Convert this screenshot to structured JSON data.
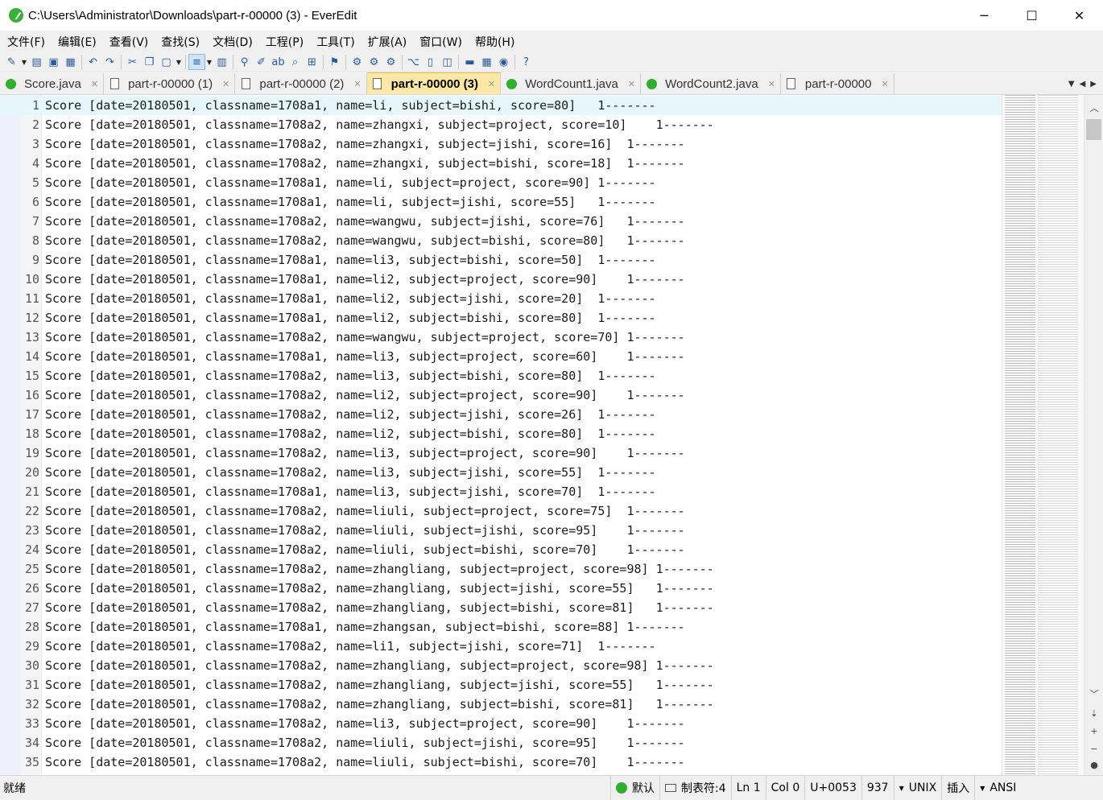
{
  "window": {
    "title": "C:\\Users\\Administrator\\Downloads\\part-r-00000 (3) - EverEdit",
    "minimize": "─",
    "maximize": "☐",
    "close": "✕"
  },
  "menu": [
    "文件(F)",
    "编辑(E)",
    "查看(V)",
    "查找(S)",
    "文档(D)",
    "工程(P)",
    "工具(T)",
    "扩展(A)",
    "窗口(W)",
    "帮助(H)"
  ],
  "tabs": [
    {
      "label": "Score.java",
      "icon": "java-file-icon",
      "active": false
    },
    {
      "label": "part-r-00000 (1)",
      "icon": "text-file-icon",
      "active": false
    },
    {
      "label": "part-r-00000 (2)",
      "icon": "text-file-icon",
      "active": false
    },
    {
      "label": "part-r-00000 (3)",
      "icon": "text-file-icon",
      "active": true
    },
    {
      "label": "WordCount1.java",
      "icon": "java-file-icon",
      "active": false
    },
    {
      "label": "WordCount2.java",
      "icon": "java-file-icon",
      "active": false
    },
    {
      "label": "part-r-00000",
      "icon": "text-file-icon",
      "active": false
    }
  ],
  "editor": {
    "current_line": 1,
    "lines": [
      {
        "n": "1",
        "text": "Score [date=20180501, classname=1708a1, name=li, subject=bishi, score=80]   1-------"
      },
      {
        "n": "2",
        "text": "Score [date=20180501, classname=1708a2, name=zhangxi, subject=project, score=10]    1-------"
      },
      {
        "n": "3",
        "text": "Score [date=20180501, classname=1708a2, name=zhangxi, subject=jishi, score=16]  1-------"
      },
      {
        "n": "4",
        "text": "Score [date=20180501, classname=1708a2, name=zhangxi, subject=bishi, score=18]  1-------"
      },
      {
        "n": "5",
        "text": "Score [date=20180501, classname=1708a1, name=li, subject=project, score=90] 1-------"
      },
      {
        "n": "6",
        "text": "Score [date=20180501, classname=1708a1, name=li, subject=jishi, score=55]   1-------"
      },
      {
        "n": "7",
        "text": "Score [date=20180501, classname=1708a2, name=wangwu, subject=jishi, score=76]   1-------"
      },
      {
        "n": "8",
        "text": "Score [date=20180501, classname=1708a2, name=wangwu, subject=bishi, score=80]   1-------"
      },
      {
        "n": "9",
        "text": "Score [date=20180501, classname=1708a1, name=li3, subject=bishi, score=50]  1-------"
      },
      {
        "n": "10",
        "text": "Score [date=20180501, classname=1708a1, name=li2, subject=project, score=90]    1-------"
      },
      {
        "n": "11",
        "text": "Score [date=20180501, classname=1708a1, name=li2, subject=jishi, score=20]  1-------"
      },
      {
        "n": "12",
        "text": "Score [date=20180501, classname=1708a1, name=li2, subject=bishi, score=80]  1-------"
      },
      {
        "n": "13",
        "text": "Score [date=20180501, classname=1708a2, name=wangwu, subject=project, score=70] 1-------"
      },
      {
        "n": "14",
        "text": "Score [date=20180501, classname=1708a1, name=li3, subject=project, score=60]    1-------"
      },
      {
        "n": "15",
        "text": "Score [date=20180501, classname=1708a2, name=li3, subject=bishi, score=80]  1-------"
      },
      {
        "n": "16",
        "text": "Score [date=20180501, classname=1708a2, name=li2, subject=project, score=90]    1-------"
      },
      {
        "n": "17",
        "text": "Score [date=20180501, classname=1708a2, name=li2, subject=jishi, score=26]  1-------"
      },
      {
        "n": "18",
        "text": "Score [date=20180501, classname=1708a2, name=li2, subject=bishi, score=80]  1-------"
      },
      {
        "n": "19",
        "text": "Score [date=20180501, classname=1708a2, name=li3, subject=project, score=90]    1-------"
      },
      {
        "n": "20",
        "text": "Score [date=20180501, classname=1708a2, name=li3, subject=jishi, score=55]  1-------"
      },
      {
        "n": "21",
        "text": "Score [date=20180501, classname=1708a1, name=li3, subject=jishi, score=70]  1-------"
      },
      {
        "n": "22",
        "text": "Score [date=20180501, classname=1708a2, name=liuli, subject=project, score=75]  1-------"
      },
      {
        "n": "23",
        "text": "Score [date=20180501, classname=1708a2, name=liuli, subject=jishi, score=95]    1-------"
      },
      {
        "n": "24",
        "text": "Score [date=20180501, classname=1708a2, name=liuli, subject=bishi, score=70]    1-------"
      },
      {
        "n": "25",
        "text": "Score [date=20180501, classname=1708a2, name=zhangliang, subject=project, score=98] 1-------"
      },
      {
        "n": "26",
        "text": "Score [date=20180501, classname=1708a2, name=zhangliang, subject=jishi, score=55]   1-------"
      },
      {
        "n": "27",
        "text": "Score [date=20180501, classname=1708a2, name=zhangliang, subject=bishi, score=81]   1-------"
      },
      {
        "n": "28",
        "text": "Score [date=20180501, classname=1708a1, name=zhangsan, subject=bishi, score=88] 1-------"
      },
      {
        "n": "29",
        "text": "Score [date=20180501, classname=1708a2, name=li1, subject=jishi, score=71]  1-------"
      },
      {
        "n": "30",
        "text": "Score [date=20180501, classname=1708a2, name=zhangliang, subject=project, score=98] 1-------"
      },
      {
        "n": "31",
        "text": "Score [date=20180501, classname=1708a2, name=zhangliang, subject=jishi, score=55]   1-------"
      },
      {
        "n": "32",
        "text": "Score [date=20180501, classname=1708a2, name=zhangliang, subject=bishi, score=81]   1-------"
      },
      {
        "n": "33",
        "text": "Score [date=20180501, classname=1708a2, name=li3, subject=project, score=90]    1-------"
      },
      {
        "n": "34",
        "text": "Score [date=20180501, classname=1708a2, name=liuli, subject=jishi, score=95]    1-------"
      },
      {
        "n": "35",
        "text": "Score [date=20180501, classname=1708a2, name=liuli, subject=bishi, score=70]    1-------"
      }
    ]
  },
  "status": {
    "ready": "就绪",
    "scheme": "默认",
    "tab_setting": "制表符:4",
    "line": "Ln 1",
    "col": "Col 0",
    "codepoint": "U+0053",
    "length": "937",
    "eol": "UNIX",
    "mode": "插入",
    "encoding": "ANSI"
  },
  "colors": {
    "active_tab": "#ffe8a6",
    "current_line": "#e6f7fb",
    "java_icon": "#2fae2f"
  }
}
